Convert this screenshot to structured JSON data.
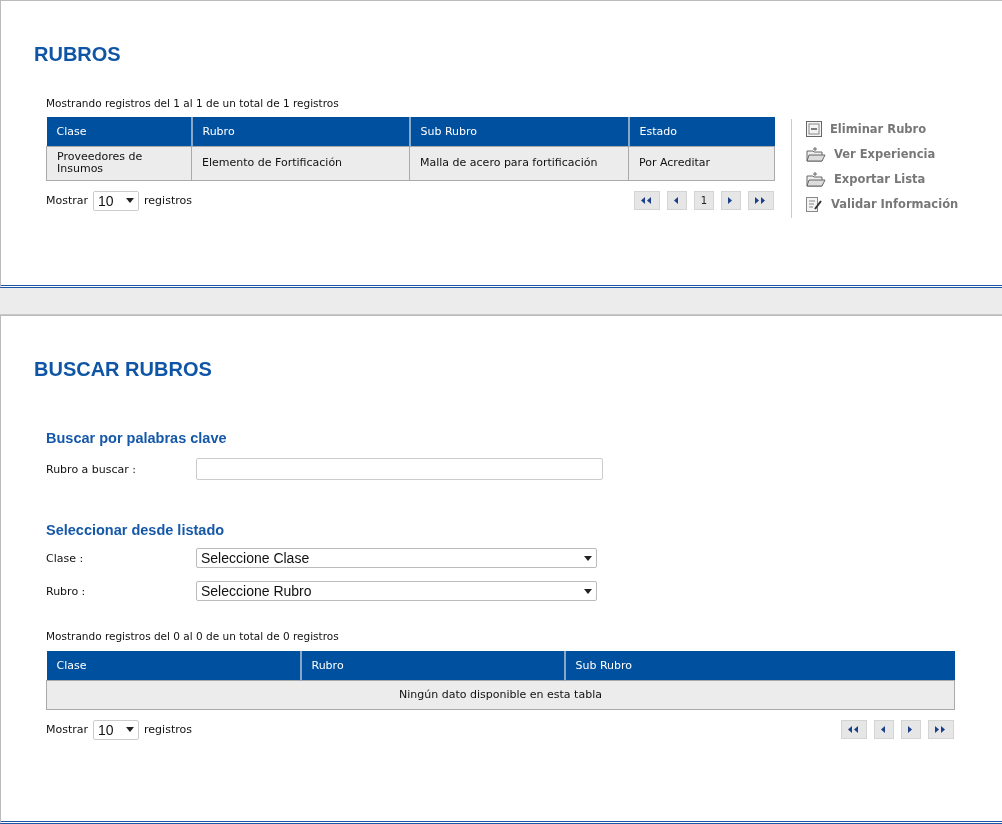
{
  "rubros": {
    "title": "RUBROS",
    "info": "Mostrando registros del 1 al 1 de un total de 1 registros",
    "columns": [
      "Clase",
      "Rubro",
      "Sub Rubro",
      "Estado"
    ],
    "rows": [
      [
        "Proveedores de Insumos",
        "Elemento de Fortificación",
        "Malla de acero para fortificación",
        "Por Acreditar"
      ]
    ],
    "length": {
      "before": "Mostrar",
      "value": "10",
      "after": "registros"
    },
    "pages": [
      "1"
    ],
    "actions": [
      {
        "kind": "delete",
        "label": "Eliminar Rubro"
      },
      {
        "kind": "folder",
        "label": "Ver Experiencia"
      },
      {
        "kind": "folder",
        "label": "Exportar Lista"
      },
      {
        "kind": "edit",
        "label": "Validar Información"
      }
    ]
  },
  "buscar": {
    "title": "BUSCAR RUBROS",
    "keyword_heading": "Buscar por palabras clave",
    "keyword_label": "Rubro a buscar :",
    "list_heading": "Seleccionar desde listado",
    "selects": [
      {
        "label": "Clase :",
        "value": "Seleccione Clase"
      },
      {
        "label": "Rubro :",
        "value": "Seleccione Rubro"
      }
    ],
    "info": "Mostrando registros del 0 al 0 de un total de 0 registros",
    "columns": [
      "Clase",
      "Rubro",
      "Sub Rubro"
    ],
    "empty": "Ningún dato disponible en esta tabla",
    "length": {
      "before": "Mostrar",
      "value": "10",
      "after": "registros"
    }
  }
}
